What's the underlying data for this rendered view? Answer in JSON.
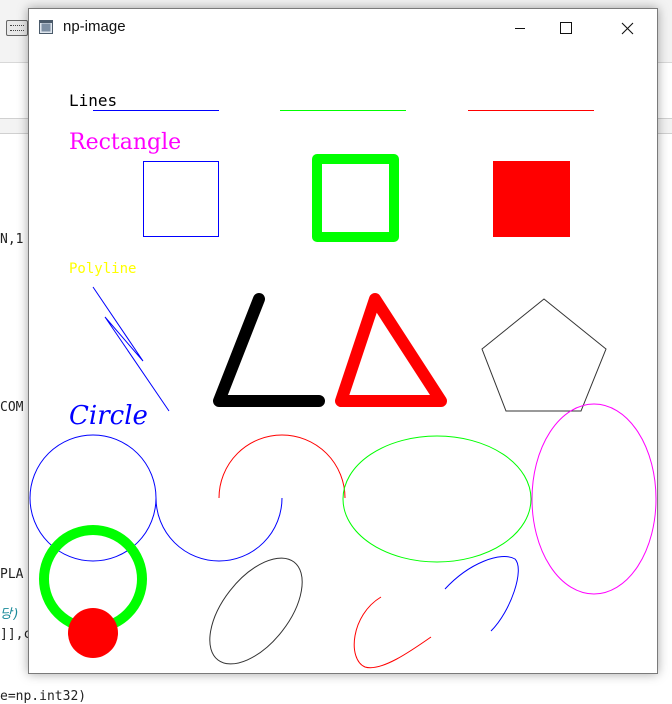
{
  "window": {
    "title": "np-image"
  },
  "canvas": {
    "labels": {
      "lines": "Lines",
      "rectangle": "Rectangle",
      "polyline": "Polyline",
      "circle": "Circle"
    },
    "colors": {
      "blue": "#0000ff",
      "green": "#00ff00",
      "red": "#ff0000",
      "black": "#000000",
      "magenta": "#ff00ff",
      "yellow": "#ffff00",
      "dark": "#333333"
    }
  },
  "background_code": {
    "line1": "N,1",
    "line2": "COM",
    "line3": "PLA",
    "line4": "당)",
    "line5": "]],c",
    "line6": "e=np.int32)"
  }
}
